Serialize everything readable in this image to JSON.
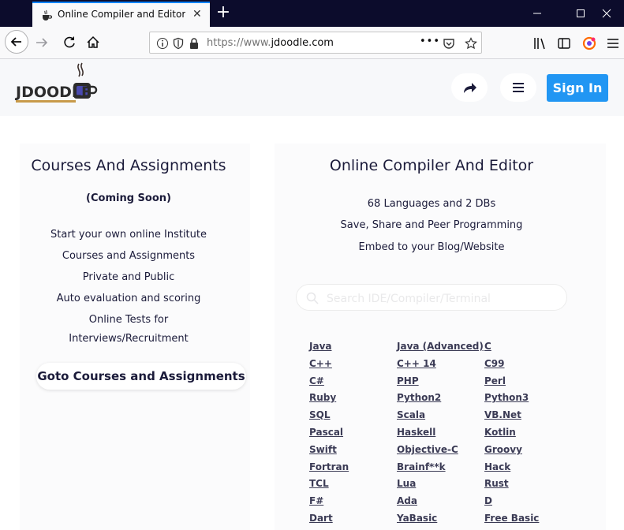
{
  "browser": {
    "tab_title": "Online Compiler and Editor/IDE",
    "tab_close": "✕",
    "new_tab": "+",
    "url_proto": "https://www.",
    "url_host": "jdoodle.com",
    "url_more": "•••"
  },
  "header": {
    "logo_text": "JDOODLE",
    "sign_in": "Sign In"
  },
  "left": {
    "title": "Courses And Assignments",
    "subtitle": "(Coming Soon)",
    "items": [
      "Start your own online Institute",
      "Courses and Assignments",
      "Private and Public",
      "Auto evaluation and scoring",
      "Online Tests for",
      "Interviews/Recruitment"
    ],
    "button": "Goto Courses and Assignments"
  },
  "right": {
    "title": "Online Compiler And Editor",
    "lines": [
      "68 Languages and 2 DBs",
      "Save, Share and Peer Programming",
      "Embed to your Blog/Website"
    ],
    "search_placeholder": "Search IDE/Compiler/Terminal"
  },
  "languages": [
    [
      "Java",
      "Java (Advanced)",
      "C"
    ],
    [
      "C++",
      "C++ 14",
      "C99"
    ],
    [
      "C#",
      "PHP",
      "Perl"
    ],
    [
      "Ruby",
      "Python2",
      "Python3"
    ],
    [
      "SQL",
      "Scala",
      "VB.Net"
    ],
    [
      "Pascal",
      "Haskell",
      "Kotlin"
    ],
    [
      "Swift",
      "Objective-C",
      "Groovy"
    ],
    [
      "Fortran",
      "Brainf**k",
      "Hack"
    ],
    [
      "TCL",
      "Lua",
      "Rust"
    ],
    [
      "F#",
      "Ada",
      "D"
    ],
    [
      "Dart",
      "YaBasic",
      "Free Basic"
    ]
  ],
  "colors": {
    "accent": "#2196f3",
    "tabstrip": "#0c0c2c",
    "text": "#1b1b3a"
  }
}
